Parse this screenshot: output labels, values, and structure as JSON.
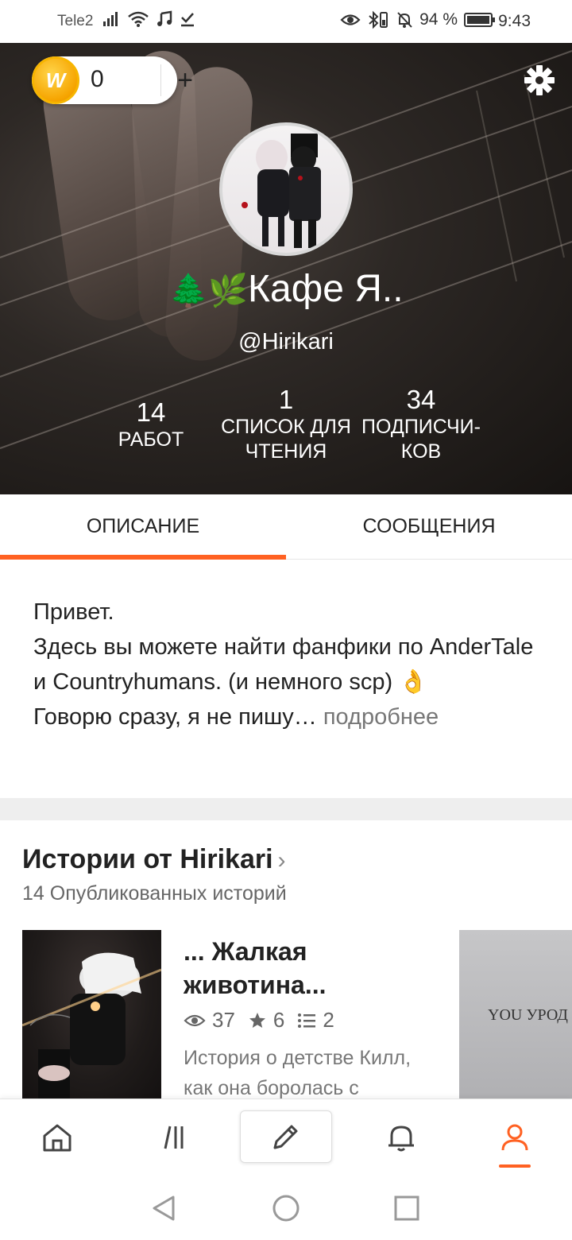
{
  "status_bar": {
    "carrier": "Tele2",
    "battery_percent": "94 %",
    "time": "9:43"
  },
  "header": {
    "coins": "0",
    "coin_symbol": "W",
    "add_symbol": "+",
    "display_name": "Кафе Я..",
    "name_emoji": "🌲🌿",
    "handle": "@Hirikari",
    "stats": {
      "works": {
        "value": "14",
        "label": "РАБОТ"
      },
      "reading_lists": {
        "value": "1",
        "label": "СПИСОК ДЛЯ\nЧТЕНИЯ"
      },
      "followers": {
        "value": "34",
        "label": "ПОДПИСЧИ-\nКОВ"
      }
    }
  },
  "tabs": {
    "about": "ОПИСАНИЕ",
    "conversations": "СООБЩЕНИЯ"
  },
  "description": {
    "text": "Привет.\nЗдесь вы можете найти фанфики по AnderTale и Countryhumans. (и немного scp) 👌\nГоворю сразу, я не пишу",
    "ellipsis": "…",
    "more": " подробнее"
  },
  "stories": {
    "title": "Истории от Hirikari",
    "chevron": "›",
    "subtitle": "14 Опубликованных историй",
    "items": [
      {
        "title": "... Жалкая животина...",
        "reads": "37",
        "votes": "6",
        "parts": "2",
        "description": "История о детстве Килл,\nкак она боролась с"
      }
    ],
    "next_cover_text": "YOU УРОД"
  },
  "bottom_nav": {
    "items": [
      "home-icon",
      "browse-icon",
      "write-icon",
      "notifications-icon",
      "profile-icon"
    ],
    "active": "profile-icon",
    "accent": "#ff6122"
  }
}
